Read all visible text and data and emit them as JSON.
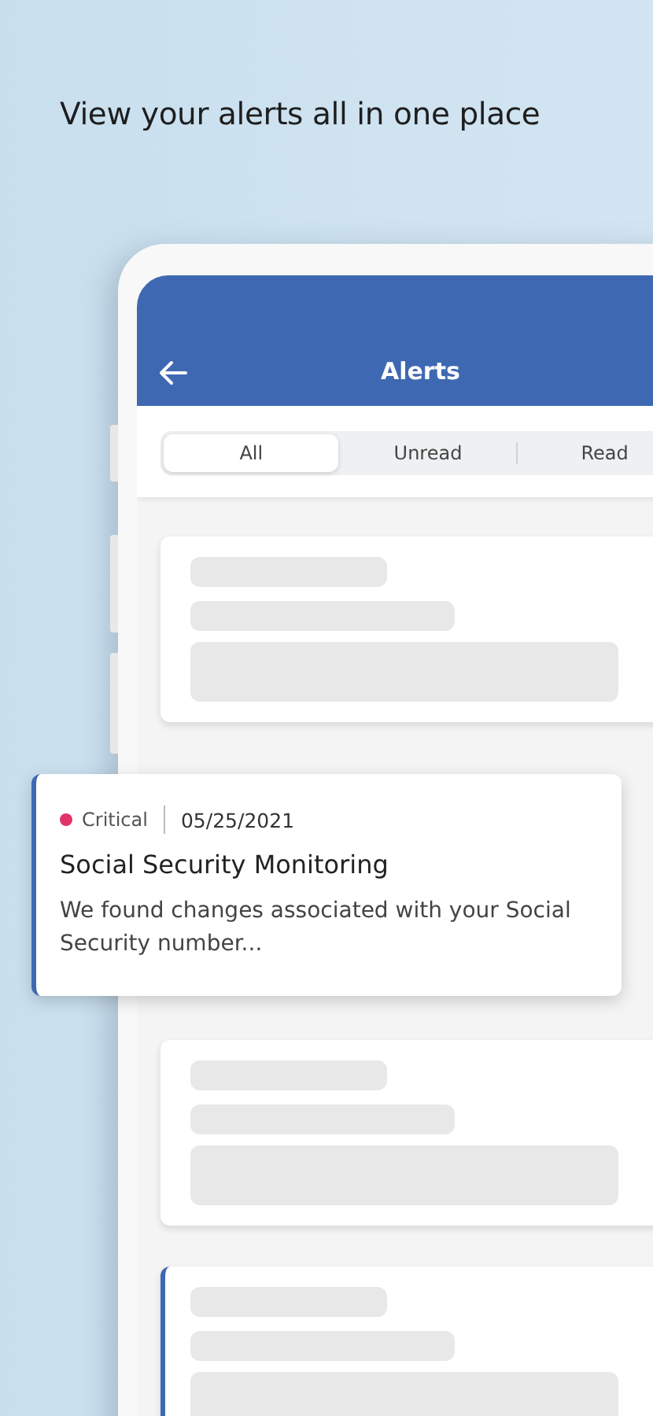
{
  "headline": "View your alerts all in one place",
  "header": {
    "title": "Alerts"
  },
  "tabs": [
    {
      "label": "All",
      "selected": true
    },
    {
      "label": "Unread",
      "selected": false
    },
    {
      "label": "Read",
      "selected": false
    }
  ],
  "cards": [
    {
      "kind": "skeleton",
      "unread": false
    },
    {
      "kind": "skeleton",
      "unread": false
    },
    {
      "kind": "skeleton",
      "unread": true
    }
  ],
  "featured_alert": {
    "severity": "Critical",
    "color": "#e0336a",
    "date": "05/25/2021",
    "title": "Social Security Monitoring",
    "body": "We found changes associated with your Social Security number...",
    "unread": true
  }
}
